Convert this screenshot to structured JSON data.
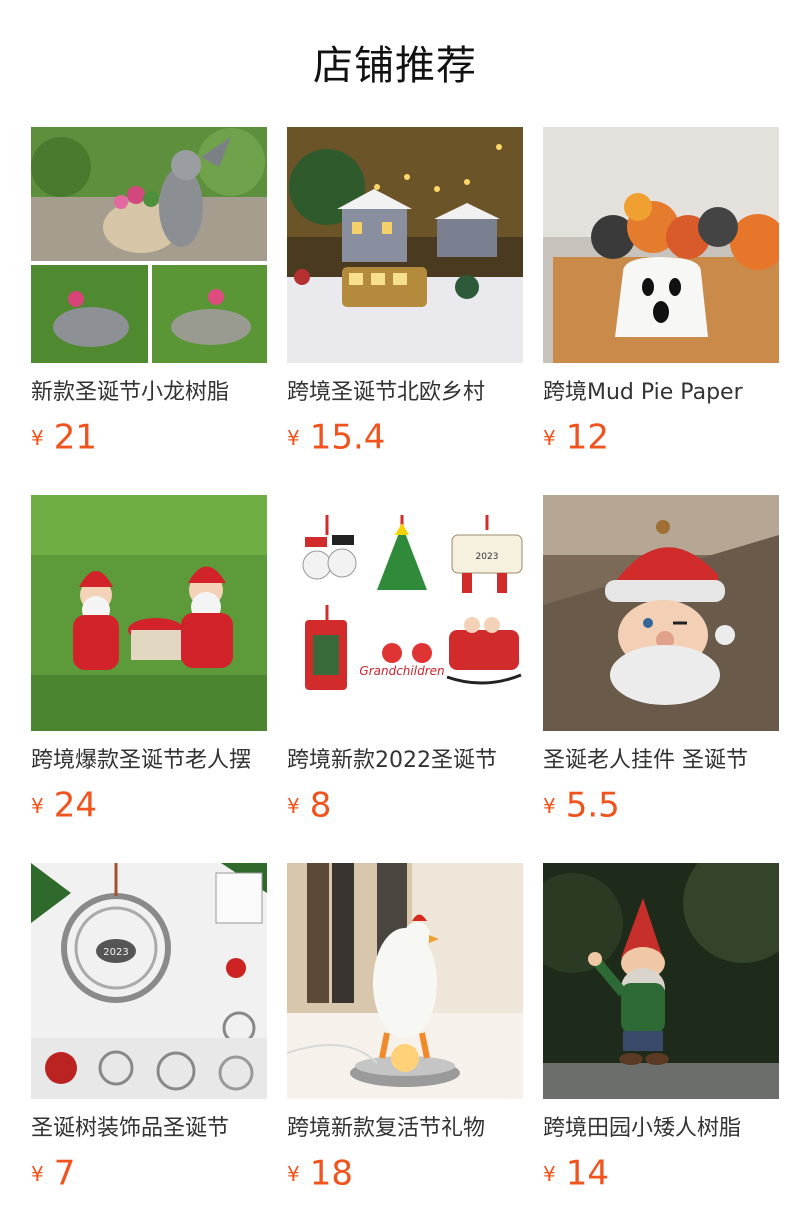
{
  "section": {
    "title": "店铺推荐"
  },
  "products": [
    {
      "name": "新款圣诞节小龙树脂",
      "currency": "¥",
      "price": "21"
    },
    {
      "name": "跨境圣诞节北欧乡村",
      "currency": "¥",
      "price": "15.4"
    },
    {
      "name": "跨境Mud Pie Paper",
      "currency": "¥",
      "price": "12"
    },
    {
      "name": "跨境爆款圣诞节老人摆",
      "currency": "¥",
      "price": "24"
    },
    {
      "name": "跨境新款2022圣诞节",
      "currency": "¥",
      "price": "8"
    },
    {
      "name": "圣诞老人挂件 圣诞节",
      "currency": "¥",
      "price": "5.5"
    },
    {
      "name": "圣诞树装饰品圣诞节",
      "currency": "¥",
      "price": "7"
    },
    {
      "name": "跨境新款复活节礼物",
      "currency": "¥",
      "price": "18"
    },
    {
      "name": "跨境田园小矮人树脂",
      "currency": "¥",
      "price": "14"
    }
  ],
  "image_text": {
    "ornament_year": "2023",
    "ornament_text": "Grandchildren"
  }
}
